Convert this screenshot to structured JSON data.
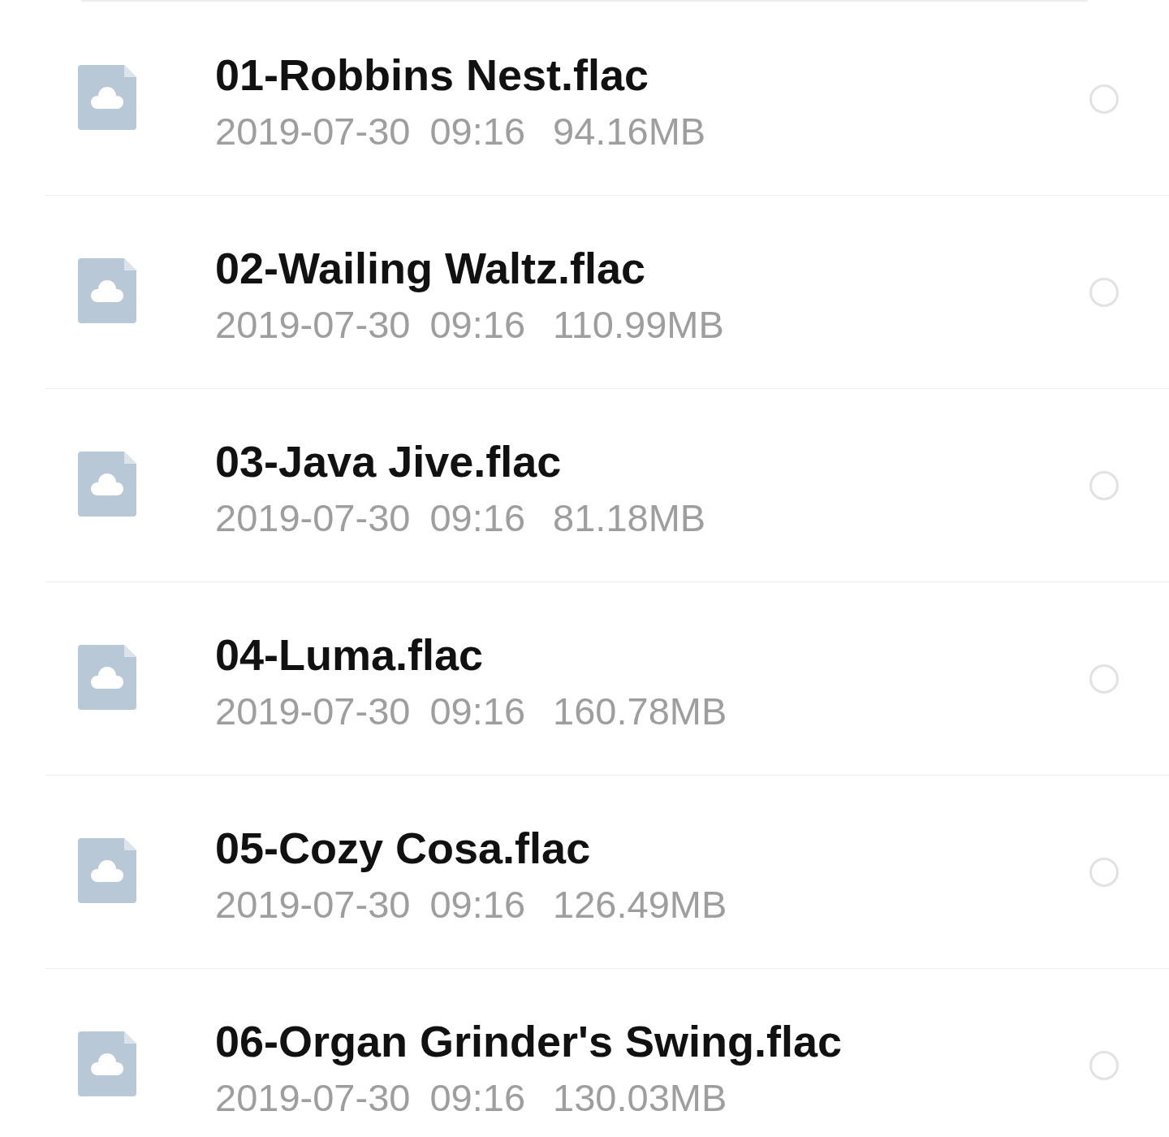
{
  "files": [
    {
      "name": "01-Robbins Nest.flac",
      "date": "2019-07-30",
      "time": "09:16",
      "size": "94.16MB",
      "selected": false
    },
    {
      "name": "02-Wailing Waltz.flac",
      "date": "2019-07-30",
      "time": "09:16",
      "size": "110.99MB",
      "selected": false
    },
    {
      "name": "03-Java Jive.flac",
      "date": "2019-07-30",
      "time": "09:16",
      "size": "81.18MB",
      "selected": false
    },
    {
      "name": "04-Luma.flac",
      "date": "2019-07-30",
      "time": "09:16",
      "size": "160.78MB",
      "selected": false
    },
    {
      "name": "05-Cozy Cosa.flac",
      "date": "2019-07-30",
      "time": "09:16",
      "size": "126.49MB",
      "selected": false
    },
    {
      "name": "06-Organ Grinder's Swing.flac",
      "date": "2019-07-30",
      "time": "09:16",
      "size": "130.03MB",
      "selected": false
    }
  ]
}
